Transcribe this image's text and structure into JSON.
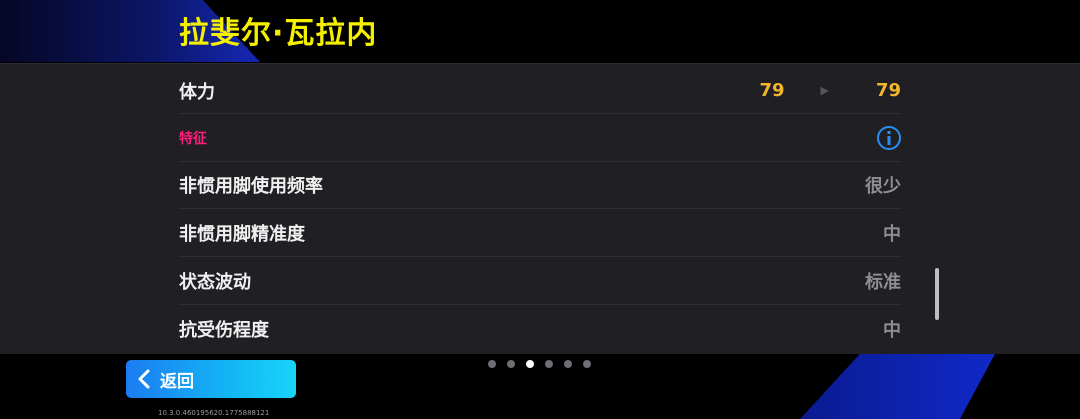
{
  "header": {
    "player_name": "拉斐尔·瓦拉内"
  },
  "stat_row": {
    "label": "体力",
    "current_value": "79",
    "new_value": "79"
  },
  "traits": {
    "section_title": "特征",
    "info_icon": "info-icon",
    "items": [
      {
        "label": "非惯用脚使用频率",
        "value": "很少"
      },
      {
        "label": "非惯用脚精准度",
        "value": "中"
      },
      {
        "label": "状态波动",
        "value": "标准"
      },
      {
        "label": "抗受伤程度",
        "value": "中"
      }
    ]
  },
  "pagination": {
    "total": 6,
    "active_index": 2
  },
  "footer": {
    "back_label": "返回",
    "back_icon": "chevron-left-icon",
    "version": "10.3.0.460195620.1775888121"
  },
  "colors": {
    "name": "#f5f000",
    "stat": "#f2b62a",
    "section": "#ff1f7a",
    "info": "#2c8df0",
    "back_button": "#1c7cf2"
  }
}
